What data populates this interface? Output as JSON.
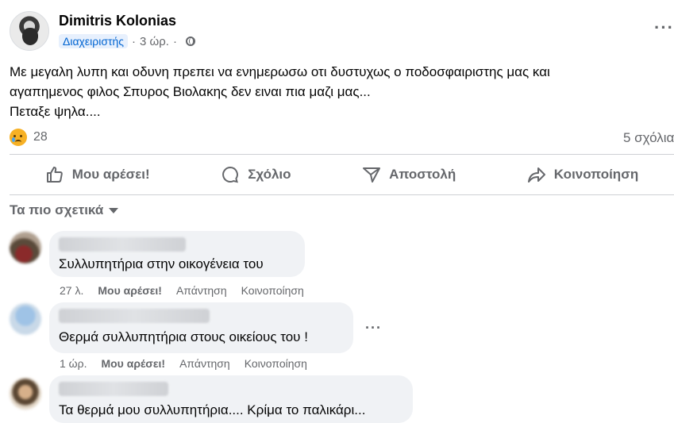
{
  "post": {
    "author": "Dimitris Kolonias",
    "badge": "Διαχειριστής",
    "time": "3 ώρ.",
    "text_lines": [
      "Με μεγαλη λυπη και οδυνη πρεπει να ενημερωσω οτι δυστυχως ο ποδοσφαιριστης μας και",
      "αγαπημενος φιλος Σπυρος Βιολακης δεν ειναι πια μαζι μας...",
      "Πεταξε ψηλα...."
    ],
    "reaction_icon": "sad-icon",
    "reaction_count": "28",
    "comments_count": "5 σχόλια"
  },
  "actions": {
    "like": "Μου αρέσει!",
    "comment": "Σχόλιο",
    "send": "Αποστολή",
    "share": "Κοινοποίηση"
  },
  "sort_label": "Τα πιο σχετικά",
  "comments": [
    {
      "text": "Συλλυπητήρια στην οικογένεια του",
      "time": "27 λ.",
      "like": "Μου αρέσει!",
      "reply": "Απάντηση",
      "share": "Κοινοποίηση"
    },
    {
      "text": "Θερμά συλλυπητήρια στους οικείους του !",
      "time": "1 ώρ.",
      "like": "Μου αρέσει!",
      "reply": "Απάντηση",
      "share": "Κοινοποίηση"
    },
    {
      "text": "Τα θερμά μου συλλυπητήρια.... Κρίμα το παλικάρι..."
    }
  ],
  "colors": {
    "secondary_text": "#65676b",
    "bubble": "#f0f2f5",
    "badge_bg": "#e7f0fd",
    "badge_text": "#0064d1"
  }
}
